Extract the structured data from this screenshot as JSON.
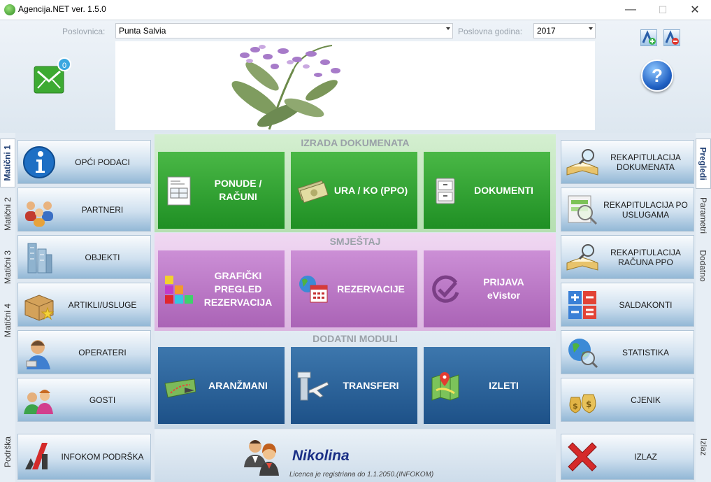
{
  "window": {
    "title": "Agencija.NET ver. 1.5.0",
    "minimize": "—",
    "maximize": "☐",
    "close": "✕"
  },
  "header": {
    "branch_label": "Poslovnica:",
    "branch_value": "Punta Salvia",
    "year_label": "Poslovna godina:",
    "year_value": "2017",
    "mail_count": "0",
    "help": "?"
  },
  "left_tabs": [
    "Matični 1",
    "Matični 2",
    "Matični 3",
    "Matični 4",
    "Podrška"
  ],
  "left_buttons": [
    "OPĆI PODACI",
    "PARTNERI",
    "OBJEKTI",
    "ARTIKLI/USLUGE",
    "OPERATERI",
    "GOSTI"
  ],
  "support_button": "INFOKOM PODRŠKA",
  "right_tabs": [
    "Pregledi",
    "Parametri",
    "Dodatno",
    "Izlaz"
  ],
  "right_buttons": [
    [
      "REKAPITULACIJA",
      "DOKUMENATA"
    ],
    [
      "REKAPITULACIJA PO",
      "USLUGAMA"
    ],
    [
      "REKAPITULACIJA",
      "RAČUNA PPO"
    ],
    [
      "SALDAKONTI"
    ],
    [
      "STATISTIKA"
    ],
    [
      "CJENIK"
    ]
  ],
  "exit_button": "IZLAZ",
  "sections": {
    "documents": {
      "title": "IZRADA DOKUMENATA",
      "tiles": [
        [
          "PONUDE /",
          "RAČUNI"
        ],
        [
          "URA / KO (PPO)"
        ],
        [
          "DOKUMENTI"
        ]
      ]
    },
    "accommodation": {
      "title": "SMJEŠTAJ",
      "tiles": [
        [
          "GRAFIČKI",
          "PREGLED",
          "REZERVACIJA"
        ],
        [
          "REZERVACIJE"
        ],
        [
          "PRIJAVA",
          "eVistor"
        ]
      ]
    },
    "modules": {
      "title": "DODATNI MODULI",
      "tiles": [
        [
          "ARANŽMANI"
        ],
        [
          "TRANSFERI"
        ],
        [
          "IZLETI"
        ]
      ]
    }
  },
  "footer": {
    "user_name": "Nikolina",
    "license": "Licenca je registriana do 1.1.2050.(INFOKOM)"
  },
  "colors": {
    "green": "#2aa02c",
    "purple": "#b972c4",
    "blue": "#285f97",
    "accent": "#1f3e73"
  }
}
